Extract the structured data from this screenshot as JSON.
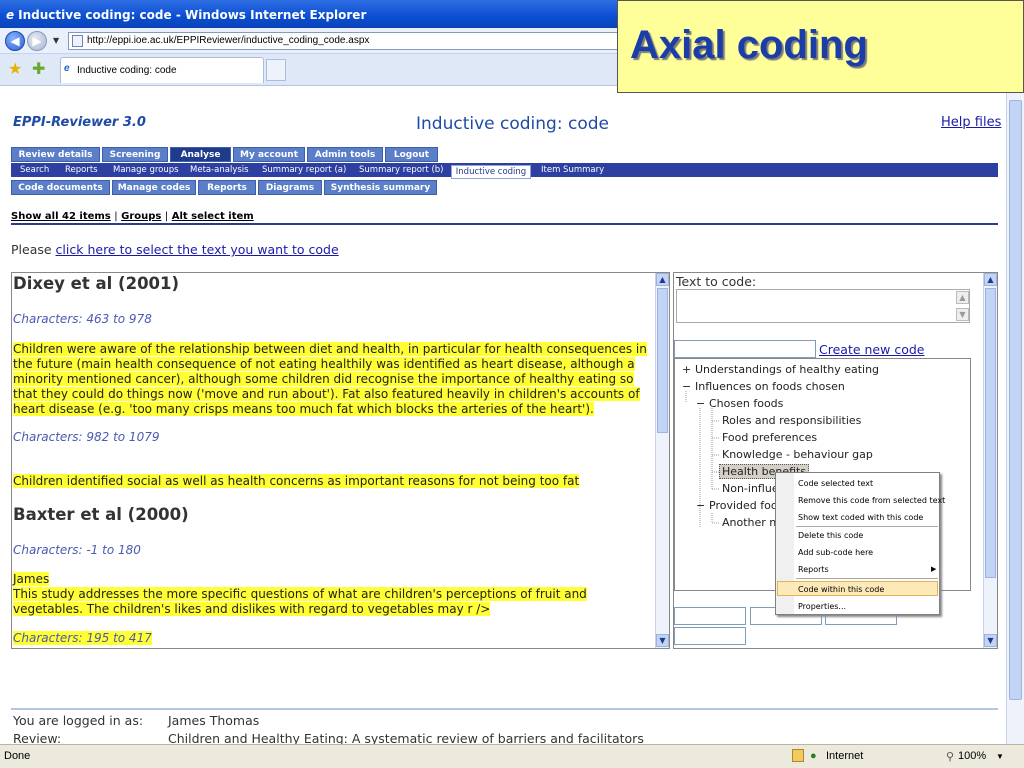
{
  "browser": {
    "window_title": "Inductive coding: code - Windows Internet Explorer",
    "address": "http://eppi.ioe.ac.uk/EPPIReviewer/inductive_coding_code.aspx",
    "tab_title": "Inductive coding: code",
    "status_text": "Done",
    "zone": "Internet",
    "zoom": "100%"
  },
  "callout": "Axial coding",
  "page": {
    "brand": "EPPI-Reviewer 3.0",
    "title": "Inductive coding: code",
    "help": "Help files",
    "main_tabs": [
      "Review details",
      "Screening",
      "Analyse",
      "My account",
      "Admin tools",
      "Logout"
    ],
    "sub_tabs": [
      "Search",
      "Reports",
      "Manage groups",
      "Meta-analysis",
      "Summary report (a)",
      "Summary report (b)",
      "Inductive coding",
      "Item Summary"
    ],
    "third_tabs": [
      "Code documents",
      "Manage codes",
      "Reports",
      "Diagrams",
      "Synthesis summary"
    ],
    "links": {
      "show_all": "Show all 42 items",
      "sep1": "|",
      "groups": "Groups",
      "sep2": "|",
      "alt_select": "Alt select item"
    },
    "please_prefix": "Please ",
    "please_link": "click here to select the text you want to code"
  },
  "document": {
    "heading1": "Dixey et al (2001)",
    "chars1": "Characters: 463 to 978",
    "para1": [
      "Children were aware of the relationship between diet and health, in particular for health consequences in",
      "the future (main health consequence of not eating healthily was identified as heart disease, although a",
      "minority mentioned cancer), although some children did recognise the importance of healthy eating so",
      "that they could do things now ('move and run about'). Fat also featured heavily in children's accounts of",
      "heart disease (e.g. 'too many crisps means too much fat which blocks the arteries of the heart')."
    ],
    "chars2": "Characters: 982 to 1079",
    "para2": "Children identified social as well as health concerns as important reasons for not being too fat",
    "heading2": "Baxter et al (2000)",
    "chars3": "Characters: -1 to 180",
    "para3": [
      "James",
      "This study addresses the more specific questions of what are children's perceptions of fruit and",
      "vegetables. The children's likes and dislikes with regard to vegetables may r />"
    ],
    "chars4": "Characters: 195 to 417"
  },
  "coding": {
    "text_to_code_label": "Text to code:",
    "create_new_code": "Create new code",
    "tree": [
      {
        "label": "Understandings of healthy eating",
        "expander": "+"
      },
      {
        "label": "Influences on foods chosen",
        "expander": "−"
      },
      {
        "label": "Chosen foods",
        "expander": "−"
      },
      {
        "label": "Roles and responsibilities",
        "expander": ""
      },
      {
        "label": "Food preferences",
        "expander": ""
      },
      {
        "label": "Knowledge - behaviour gap",
        "expander": ""
      },
      {
        "label": "Health benefits",
        "expander": ""
      },
      {
        "label": "Non-influer",
        "expander": ""
      },
      {
        "label": "Provided food",
        "expander": "−"
      },
      {
        "label": "Another ne",
        "expander": ""
      }
    ]
  },
  "context_menu": [
    "Code selected text",
    "Remove this code from selected text",
    "Show text coded with this code",
    "Delete this code",
    "Add sub-code here",
    "Reports",
    "Code within this code",
    "Properties..."
  ],
  "footer": {
    "logged_in_label": "You are logged in as:",
    "logged_in_value": "James Thomas",
    "review_label": "Review:",
    "review_value": "Children and Healthy Eating: A systematic review of barriers and facilitators"
  }
}
